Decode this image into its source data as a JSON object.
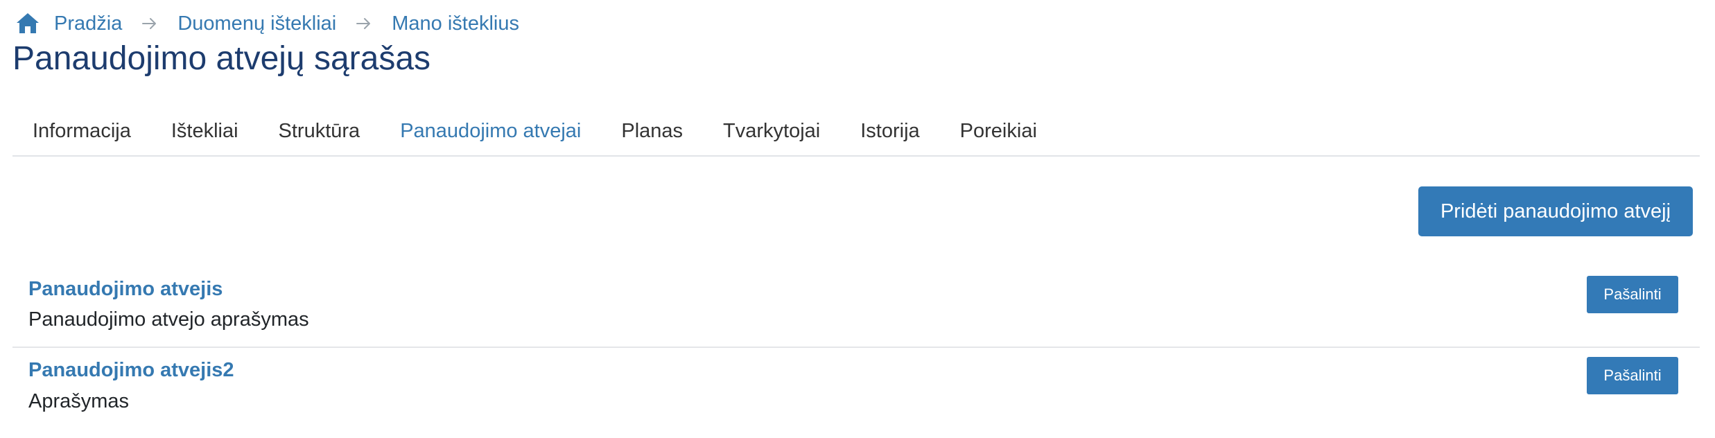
{
  "breadcrumb": {
    "home_icon": "home-icon",
    "items": [
      {
        "label": "Pradžia"
      },
      {
        "label": "Duomenų ištekliai"
      },
      {
        "label": "Mano išteklius"
      }
    ],
    "separator_icon": "arrow-right-icon"
  },
  "page": {
    "title": "Panaudojimo atvejų sąrašas"
  },
  "tabs": [
    {
      "label": "Informacija",
      "active": false
    },
    {
      "label": "Ištekliai",
      "active": false
    },
    {
      "label": "Struktūra",
      "active": false
    },
    {
      "label": "Panaudojimo atvejai",
      "active": true
    },
    {
      "label": "Planas",
      "active": false
    },
    {
      "label": "Tvarkytojai",
      "active": false
    },
    {
      "label": "Istorija",
      "active": false
    },
    {
      "label": "Poreikiai",
      "active": false
    }
  ],
  "actions": {
    "add_label": "Pridėti panaudojimo atvejį"
  },
  "usecases": [
    {
      "title": "Panaudojimo atvejis",
      "description": "Panaudojimo atvejo aprašymas",
      "delete_label": "Pašalinti"
    },
    {
      "title": "Panaudojimo atvejis2",
      "description": "Aprašymas",
      "delete_label": "Pašalinti"
    }
  ],
  "colors": {
    "link": "#3579b1",
    "title": "#1d3c6e",
    "primary": "#337ab7",
    "text": "#212529",
    "border": "#e1e4e8"
  }
}
